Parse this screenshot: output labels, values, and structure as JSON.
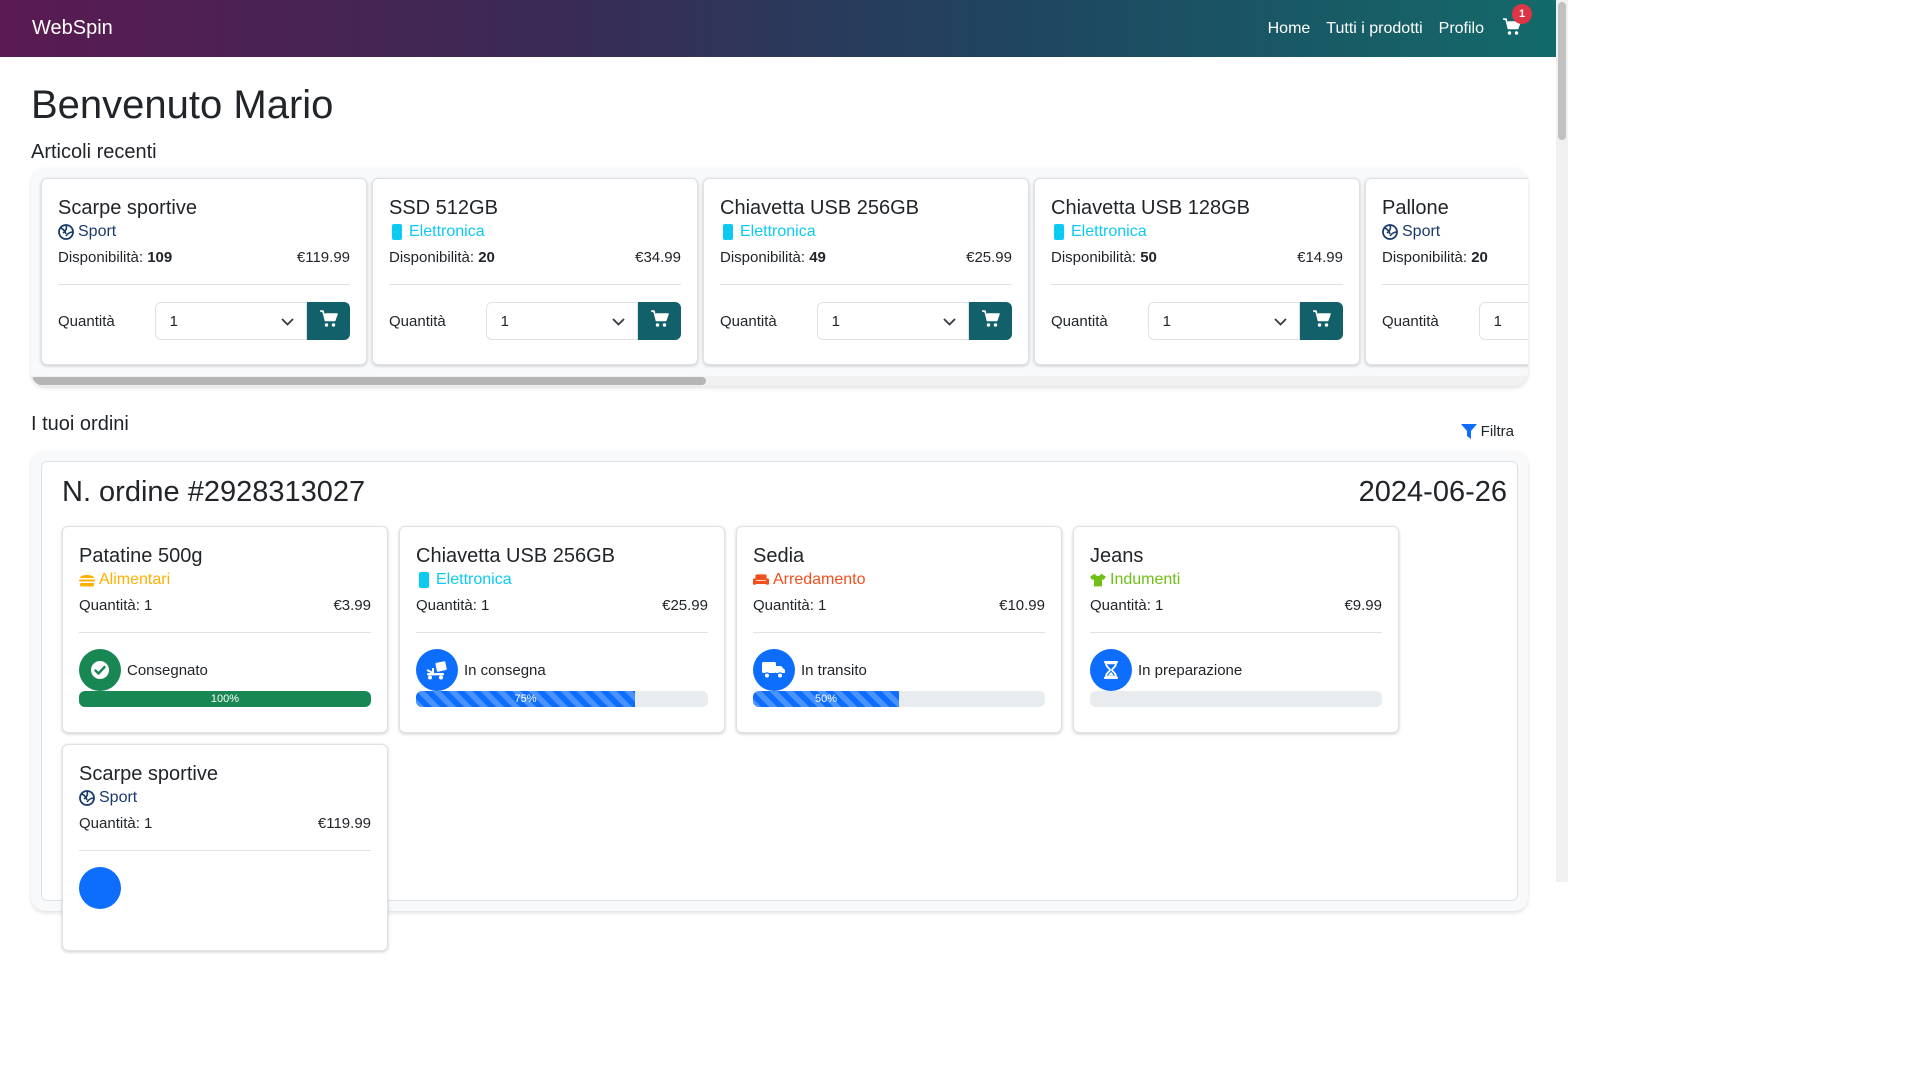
{
  "nav": {
    "brand": "WebSpin",
    "links": [
      "Home",
      "Tutti i prodotti",
      "Profilo"
    ],
    "cart_count": "1"
  },
  "page": {
    "welcome": "Benvenuto Mario",
    "recent_title": "Articoli recenti",
    "orders_title": "I tuoi ordini",
    "filter_label": "Filtra"
  },
  "recent": [
    {
      "title": "Scarpe sportive",
      "category": "Sport",
      "cat_color": "#1a3a6b",
      "cat_icon": "volleyball-icon",
      "avail_label": "Disponibilità:",
      "avail": "109",
      "price": "€119.99",
      "qty_label": "Quantità",
      "qty": "1"
    },
    {
      "title": "SSD 512GB",
      "category": "Elettronica",
      "cat_color": "#0dcaf0",
      "cat_icon": "mobile-icon",
      "avail_label": "Disponibilità:",
      "avail": "20",
      "price": "€34.99",
      "qty_label": "Quantità",
      "qty": "1"
    },
    {
      "title": "Chiavetta USB 256GB",
      "category": "Elettronica",
      "cat_color": "#0dcaf0",
      "cat_icon": "mobile-icon",
      "avail_label": "Disponibilità:",
      "avail": "49",
      "price": "€25.99",
      "qty_label": "Quantità",
      "qty": "1"
    },
    {
      "title": "Chiavetta USB 128GB",
      "category": "Elettronica",
      "cat_color": "#0dcaf0",
      "cat_icon": "mobile-icon",
      "avail_label": "Disponibilità:",
      "avail": "50",
      "price": "€14.99",
      "qty_label": "Quantità",
      "qty": "1"
    },
    {
      "title": "Pallone",
      "category": "Sport",
      "cat_color": "#1a3a6b",
      "cat_icon": "volleyball-icon",
      "avail_label": "Disponibilità:",
      "avail": "20",
      "price": "",
      "qty_label": "Quantità",
      "qty": "1"
    }
  ],
  "order": {
    "number": "N. ordine #2928313027",
    "date": "2024-06-26",
    "items": [
      {
        "title": "Patatine 500g",
        "category": "Alimentari",
        "cat_color": "#ffb000",
        "cat_icon": "burger-icon",
        "qty_text": "Quantità: 1",
        "price": "€3.99",
        "status": "Consegnato",
        "status_color": "#198754",
        "status_icon": "check-circle-icon",
        "progress": 100,
        "progress_label": "100%",
        "bar": "green"
      },
      {
        "title": "Chiavetta USB 256GB",
        "category": "Elettronica",
        "cat_color": "#0dcaf0",
        "cat_icon": "mobile-icon",
        "qty_text": "Quantità: 1",
        "price": "€25.99",
        "status": "In consegna",
        "status_color": "#0d6efd",
        "status_icon": "delivery-icon",
        "progress": 75,
        "progress_label": "75%",
        "bar": "striped"
      },
      {
        "title": "Sedia",
        "category": "Arredamento",
        "cat_color": "#f0501e",
        "cat_icon": "couch-icon",
        "qty_text": "Quantità: 1",
        "price": "€10.99",
        "status": "In transito",
        "status_color": "#0d6efd",
        "status_icon": "truck-icon",
        "progress": 50,
        "progress_label": "50%",
        "bar": "striped"
      },
      {
        "title": "Jeans",
        "category": "Indumenti",
        "cat_color": "#6fbf14",
        "cat_icon": "shirt-icon",
        "qty_text": "Quantità: 1",
        "price": "€9.99",
        "status": "In preparazione",
        "status_color": "#0d6efd",
        "status_icon": "hourglass-icon",
        "progress": 0,
        "progress_label": "",
        "bar": "striped"
      },
      {
        "title": "Scarpe sportive",
        "category": "Sport",
        "cat_color": "#1a3a6b",
        "cat_icon": "volleyball-icon",
        "qty_text": "Quantità: 1",
        "price": "€119.99",
        "status": "",
        "status_color": "#0d6efd",
        "status_icon": "",
        "progress": 0,
        "progress_label": "",
        "bar": "striped"
      }
    ]
  }
}
